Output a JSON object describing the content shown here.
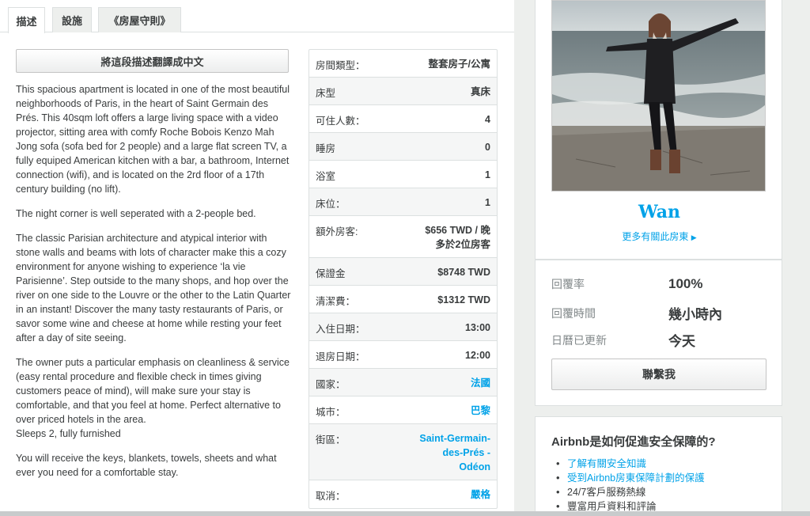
{
  "tabs": [
    {
      "label": "描述",
      "active": true
    },
    {
      "label": "設施",
      "active": false
    },
    {
      "label": "《房屋守則》",
      "active": false
    }
  ],
  "translate_button": "將這段描述翻譯成中文",
  "description": [
    "This spacious apartment is located in one of the most beautiful neighborhoods of Paris, in the heart of Saint Germain des Prés. This 40sqm loft offers a large living space with a video projector, sitting area with comfy Roche Bobois Kenzo Mah Jong sofa (sofa bed for 2 people) and a large flat screen TV, a fully equiped American kitchen with a bar, a bathroom, Internet connection (wifi), and is located on the 2rd floor of a 17th century building (no lift).",
    "The night corner is well seperated with a 2-people bed.",
    "The classic Parisian architecture and atypical interior with stone walls and beams with lots of character make this a cozy environment for anyone wishing to experience ‘la vie Parisienne’. Step outside to the many shops, and hop over the river on one side to the Louvre or the other to the Latin Quarter in an instant! Discover the many tasty restaurants of Paris, or savor some wine and cheese at home while resting your feet after a day of site seeing.",
    "The owner puts a particular emphasis on cleanliness & service (easy rental procedure and flexible check in times giving customers peace of mind), will make sure your stay is comfortable, and that you feel at home. Perfect alternative to over priced hotels in the area.\nSleeps 2, fully furnished",
    "You will receive the keys, blankets, towels, sheets and what ever you need for a comfortable stay."
  ],
  "details": [
    {
      "label": "房間類型：",
      "value": "整套房子/公寓",
      "link": false
    },
    {
      "label": "床型",
      "value": "真床",
      "link": false
    },
    {
      "label": "可住人數：",
      "value": "4",
      "link": false
    },
    {
      "label": "睡房",
      "value": "0",
      "link": false
    },
    {
      "label": "浴室",
      "value": "1",
      "link": false
    },
    {
      "label": "床位：",
      "value": "1",
      "link": false
    },
    {
      "label": "額外房客:",
      "value": "$656 TWD / 晚\n多於2位房客",
      "link": false
    },
    {
      "label": "保證金",
      "value": "$8748 TWD",
      "link": false
    },
    {
      "label": "清潔費：",
      "value": "$1312 TWD",
      "link": false
    },
    {
      "label": "入住日期：",
      "value": "13:00",
      "link": false
    },
    {
      "label": "退房日期：",
      "value": "12:00",
      "link": false
    },
    {
      "label": "國家：",
      "value": "法國",
      "link": true
    },
    {
      "label": "城市：",
      "value": "巴黎",
      "link": true
    },
    {
      "label": "街區：",
      "value": "Saint-Germain-\ndes-Prés -\nOdéon",
      "link": true
    },
    {
      "label": "取消：",
      "value": "嚴格",
      "link": true
    }
  ],
  "host": {
    "name": "Wan",
    "more_link": "更多有關此房東",
    "more_icon": "caret-right-icon"
  },
  "stats": [
    {
      "label": "回覆率",
      "value": "100%"
    },
    {
      "label": "回覆時間",
      "value": "幾小時內"
    },
    {
      "label": "日曆已更新",
      "value": "今天"
    }
  ],
  "contact_button": "聯繫我",
  "safety": {
    "title": "Airbnb是如何促進安全保障的?",
    "items": [
      {
        "text": "了解有關安全知識",
        "link": true
      },
      {
        "text": "受到Airbnb房東保障計劃的保護",
        "link": true
      },
      {
        "text": "24/7客戶服務熱線",
        "link": false
      },
      {
        "text": "豐富用戶資料和評論",
        "link": false
      }
    ]
  },
  "colors": {
    "link": "#00a2e8",
    "text": "#393c3d",
    "muted": "#82888a",
    "panel_bg": "#edefed"
  }
}
